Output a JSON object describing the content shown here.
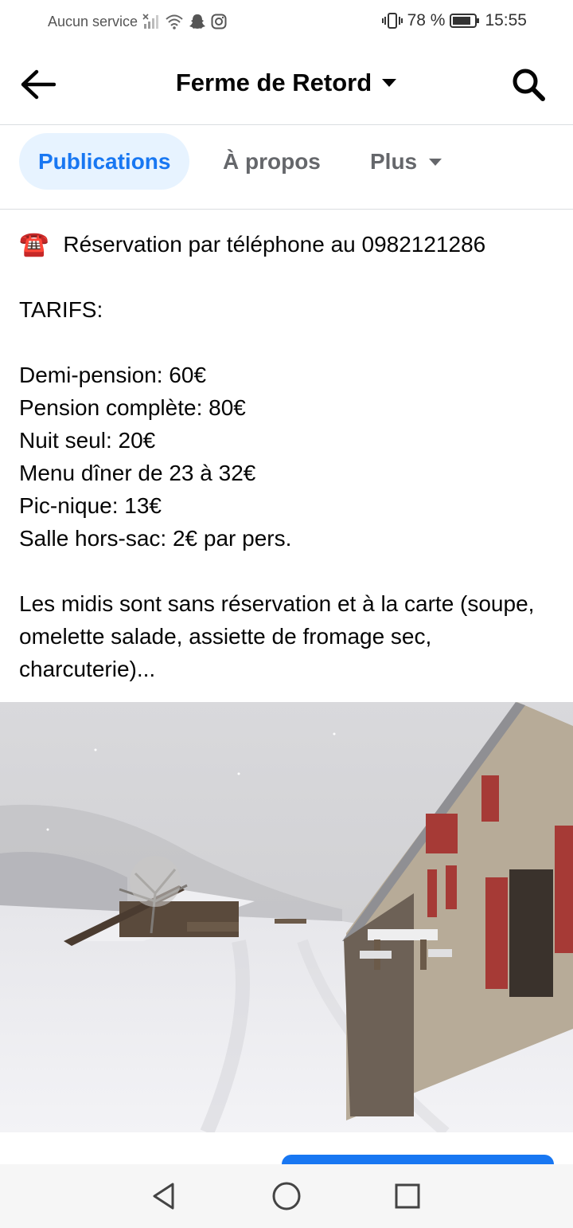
{
  "status_bar": {
    "carrier": "Aucun service",
    "battery_percent": "78 %",
    "time": "15:55",
    "icons": [
      "signal-off-icon",
      "wifi-icon",
      "snapchat-icon",
      "instagram-icon",
      "vibrate-icon",
      "battery-icon"
    ]
  },
  "header": {
    "title": "Ferme de Retord",
    "back_icon": "back-arrow-icon",
    "dropdown_icon": "caret-down-icon",
    "search_icon": "search-icon"
  },
  "tabs": [
    {
      "label": "Publications",
      "active": true
    },
    {
      "label": "À propos",
      "active": false
    },
    {
      "label": "Plus",
      "active": false
    }
  ],
  "post": {
    "phone_icon": "☎️",
    "phone_line": "Réservation par téléphone au 0982121286",
    "tarifs_heading": "TARIFS:",
    "prices": [
      "Demi-pension: 60€",
      "Pension complète: 80€",
      "Nuit seul: 20€",
      "Menu dîner de 23 à 32€",
      "Pic-nique: 13€",
      "Salle hors-sac: 2€ par pers."
    ],
    "paragraph": "Les midis sont sans réservation et à la carte (soupe, omelette salade, assiette de fromage sec, charcuterie)..."
  },
  "photo": {
    "description_icon": "snowy-farm-photo"
  },
  "colors": {
    "accent": "#1877f2",
    "tab_active_bg": "#e7f3ff",
    "muted_text": "#65676b",
    "divider": "#dadde1"
  }
}
